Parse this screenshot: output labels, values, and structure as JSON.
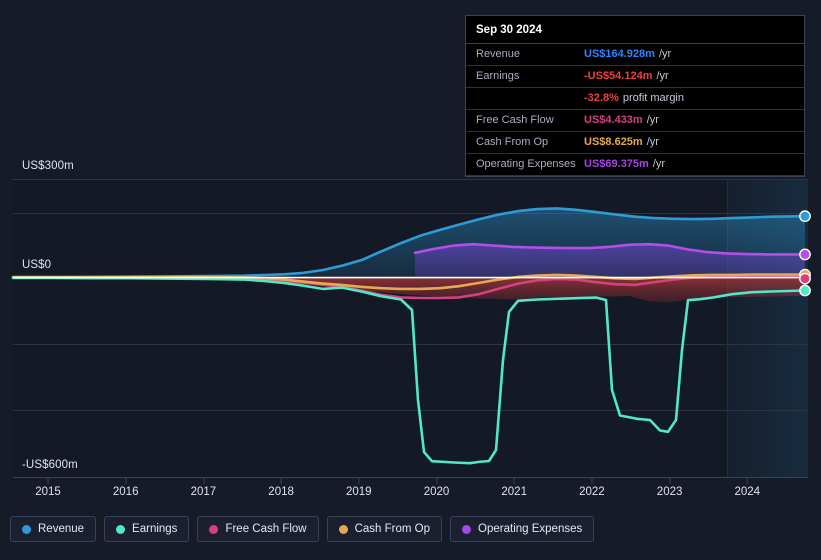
{
  "tooltip": {
    "date": "Sep 30 2024",
    "rows": [
      {
        "label": "Revenue",
        "value": "US$164.928m",
        "unit": "/yr",
        "color": "#2f86ff"
      },
      {
        "label": "Earnings",
        "value": "-US$54.124m",
        "unit": "/yr",
        "color": "#e8433c"
      },
      {
        "label": "",
        "value": "-32.8%",
        "unit": "profit margin",
        "color": "#e8433c"
      },
      {
        "label": "Free Cash Flow",
        "value": "US$4.433m",
        "unit": "/yr",
        "color": "#d6407f"
      },
      {
        "label": "Cash From Op",
        "value": "US$8.625m",
        "unit": "/yr",
        "color": "#e8a84f"
      },
      {
        "label": "Operating Expenses",
        "value": "US$69.375m",
        "unit": "/yr",
        "color": "#a845e8"
      }
    ]
  },
  "legend": {
    "items": [
      {
        "label": "Revenue",
        "color": "#2e9bd6"
      },
      {
        "label": "Earnings",
        "color": "#4fe8c8"
      },
      {
        "label": "Free Cash Flow",
        "color": "#d6407f"
      },
      {
        "label": "Cash From Op",
        "color": "#e8a84f"
      },
      {
        "label": "Operating Expenses",
        "color": "#a845e8"
      }
    ]
  },
  "axes": {
    "y_top_label": "US$300m",
    "y_zero_label": "US$0",
    "y_bottom_label": "-US$600m",
    "x_labels": [
      "2015",
      "2016",
      "2017",
      "2018",
      "2019",
      "2020",
      "2021",
      "2022",
      "2023",
      "2024"
    ]
  },
  "chart_data": {
    "type": "area",
    "title": "",
    "xlabel": "",
    "ylabel": "US$",
    "ylim": [
      -600,
      300
    ],
    "y_ticks": [
      300,
      200,
      0,
      -200,
      -400,
      -600
    ],
    "y_tick_labels": [
      "US$300m",
      "",
      "US$0",
      "",
      "",
      "-US$600m"
    ],
    "grid": true,
    "legend_position": "bottom",
    "x_tick_labels": [
      "2015",
      "2016",
      "2017",
      "2018",
      "2019",
      "2020",
      "2021",
      "2022",
      "2023",
      "2024"
    ],
    "x": [
      2015.0,
      2015.5,
      2016.0,
      2016.5,
      2017.0,
      2017.5,
      2018.0,
      2018.25,
      2018.5,
      2018.75,
      2019.0,
      2019.25,
      2019.5,
      2019.75,
      2020.0,
      2020.25,
      2020.5,
      2020.75,
      2021.0,
      2021.25,
      2021.5,
      2021.75,
      2022.0,
      2022.25,
      2022.5,
      2022.75,
      2023.0,
      2023.25,
      2023.5,
      2023.75,
      2024.0,
      2024.25,
      2024.5,
      2024.75
    ],
    "series": [
      {
        "name": "Revenue",
        "color": "#2e9bd6",
        "fill": "rgba(46,120,190,0.30)",
        "values": [
          2,
          2,
          3,
          3,
          4,
          4,
          5,
          6,
          8,
          12,
          18,
          30,
          48,
          72,
          96,
          118,
          136,
          152,
          168,
          182,
          193,
          199,
          201,
          197,
          190,
          183,
          176,
          172,
          170,
          169,
          170,
          172,
          174,
          176
        ]
      },
      {
        "name": "Earnings",
        "color": "#4fe8c8",
        "fill": "rgba(150,40,50,0.55)",
        "values": [
          -1,
          -1,
          -2,
          -2,
          -3,
          -4,
          -6,
          -10,
          -16,
          -24,
          -34,
          -30,
          -42,
          -56,
          -66,
          -520,
          -560,
          -548,
          -528,
          -66,
          -62,
          -60,
          -58,
          -56,
          -330,
          -368,
          -378,
          -72,
          -68,
          -62,
          -58,
          -56,
          -55,
          -54
        ]
      },
      {
        "name": "Free Cash Flow",
        "color": "#d6407f",
        "fill": "none",
        "values": [
          0,
          0,
          -1,
          -1,
          -2,
          -2,
          -3,
          -5,
          -9,
          -15,
          -22,
          -28,
          -40,
          -52,
          -60,
          -62,
          -62,
          -60,
          -50,
          -34,
          -18,
          -8,
          -4,
          -6,
          -14,
          -20,
          -22,
          -14,
          -6,
          0,
          2,
          3,
          4,
          4
        ]
      },
      {
        "name": "Cash From Op",
        "color": "#e8a84f",
        "fill": "none",
        "values": [
          1,
          1,
          1,
          1,
          1,
          1,
          0,
          -2,
          -6,
          -12,
          -18,
          -22,
          -28,
          -32,
          -34,
          -34,
          -32,
          -26,
          -16,
          -6,
          2,
          6,
          8,
          6,
          2,
          -2,
          -4,
          0,
          4,
          7,
          8,
          8,
          9,
          9
        ]
      },
      {
        "name": "Operating Expenses",
        "color": "#a845e8",
        "fill": "rgba(90,60,180,0.42)",
        "start_x": 2019.75,
        "values_from_start": [
          74,
          86,
          96,
          100,
          96,
          92,
          90,
          89,
          88,
          88,
          92,
          98,
          100,
          96,
          84,
          76,
          72,
          70,
          69,
          69,
          69,
          69,
          69
        ]
      }
    ],
    "forecast_boundary_year": 2024.05,
    "endpoints": [
      {
        "name": "Revenue",
        "value": 164.928,
        "color": "#2e9bd6"
      },
      {
        "name": "Operating Expenses",
        "value": 69.375,
        "color": "#a845e8"
      },
      {
        "name": "Cash From Op",
        "value": 8.625,
        "color": "#e8a84f"
      },
      {
        "name": "Free Cash Flow",
        "value": 4.433,
        "color": "#d6407f"
      },
      {
        "name": "Earnings",
        "value": -54.124,
        "color": "#4fe8c8"
      }
    ]
  }
}
